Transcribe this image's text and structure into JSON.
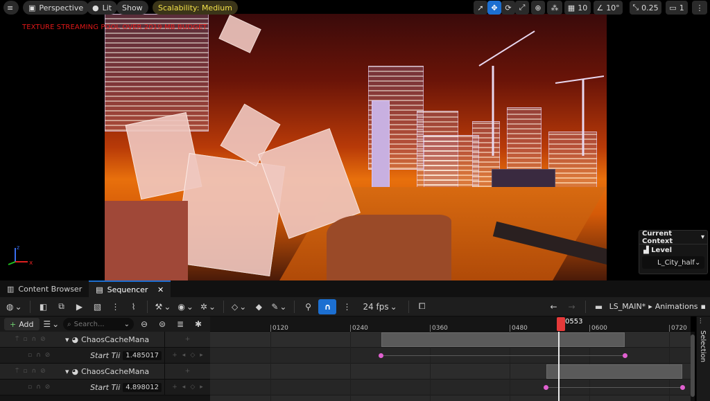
{
  "viewport": {
    "menu_icon": "hamburger-icon",
    "perspective_label": "Perspective",
    "lit_label": "Lit",
    "show_label": "Show",
    "scalability_label": "Scalability: Medium",
    "grid_value": "10",
    "angle_value": "10°",
    "scale_value": "0.25",
    "camera_speed": "1",
    "warning_text": "TEXTURE STREAMING POOL OVER 2019 MB BUDGET",
    "context": {
      "title": "Current Context",
      "level_label": "Level",
      "level_value": "L_City_half"
    }
  },
  "tabs": [
    {
      "label": "Content Browser"
    },
    {
      "label": "Sequencer"
    }
  ],
  "toolbar": {
    "fps": "24 fps",
    "sequence_name": "LS_MAIN*",
    "sequence_child": "Animations"
  },
  "outliner": {
    "add_label": "Add",
    "search_placeholder": "Search...",
    "rows": [
      {
        "type": "track",
        "name": "ChaosCacheMana"
      },
      {
        "type": "sub",
        "name": "Start Tii",
        "value": "1.485017"
      },
      {
        "type": "track",
        "name": "ChaosCacheMana"
      },
      {
        "type": "sub",
        "name": "Start Tii",
        "value": "4.898012"
      }
    ]
  },
  "timeline": {
    "ticks": [
      "0120",
      "0240",
      "0360",
      "0480",
      "0600",
      "0720"
    ],
    "playhead": "0553",
    "colors": {
      "playhead": "#e53a3a",
      "keyframe": "#e060d0",
      "accent": "#1c6fd1"
    }
  },
  "sidepanel": {
    "selection_label": "Selection"
  }
}
